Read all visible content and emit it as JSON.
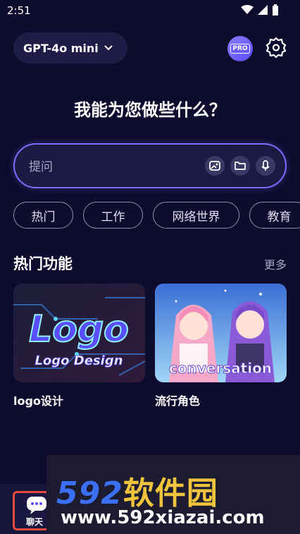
{
  "status_bar": {
    "time": "2:51"
  },
  "header": {
    "model_name": "GPT-4o mini",
    "pro_label": "PRO"
  },
  "title": "我能为您做些什么？",
  "prompt": {
    "placeholder": "提问"
  },
  "chips": [
    "热门",
    "工作",
    "网络世界",
    "教育"
  ],
  "section": {
    "title": "热门功能",
    "more": "更多"
  },
  "cards": [
    {
      "label": "logo设计",
      "image_text_main": "Logo",
      "image_text_sub": "Logo Design"
    },
    {
      "label": "流行角色",
      "image_text": "conversation"
    }
  ],
  "bottom_nav": {
    "chat_label": "聊天"
  },
  "watermark": {
    "brand_digits": "592",
    "brand_cn": "软件园",
    "url": "www.592xiazai.com"
  },
  "colors": {
    "background": "#0d0b2e",
    "accent": "#7b6cff",
    "chip_border": "#8e8cb0",
    "watermark_blue": "#3b6ff5",
    "watermark_yellow": "#f0c43d"
  }
}
